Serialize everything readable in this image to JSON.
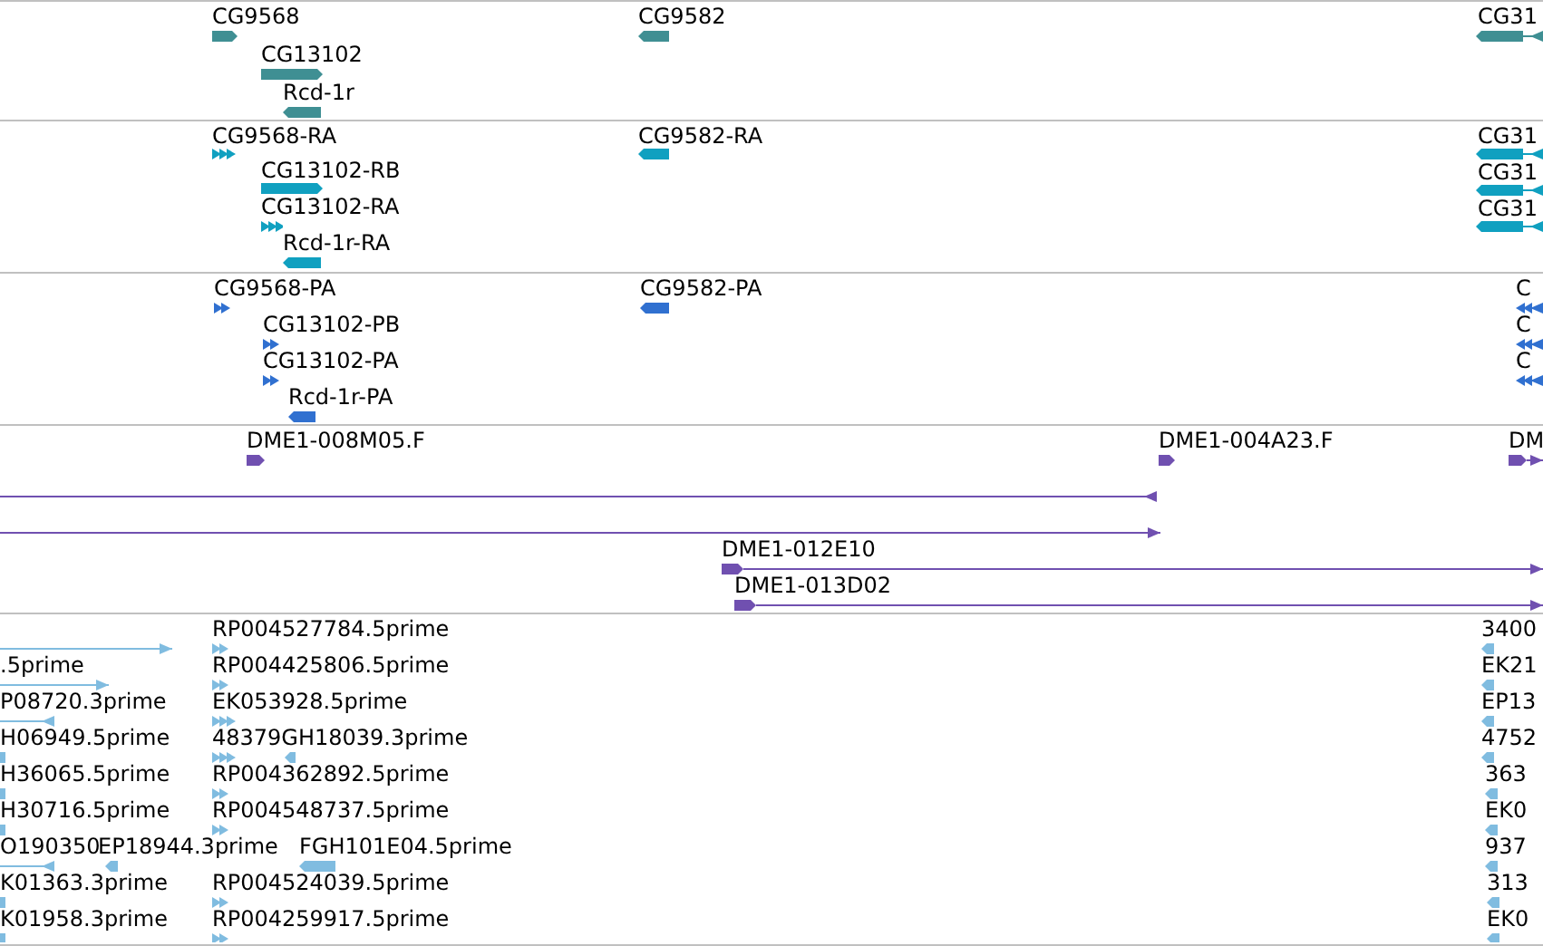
{
  "tracks": [
    {
      "color": "#3f8f93",
      "features": [
        {
          "label": "CG9568",
          "reverse": false
        },
        {
          "label": "CG13102",
          "reverse": false
        },
        {
          "label": "Rcd-1r",
          "reverse": true
        },
        {
          "label": "CG9582",
          "reverse": true
        },
        {
          "label": "CG31",
          "reverse": true
        }
      ]
    },
    {
      "color": "#10a0c0",
      "features": [
        {
          "label": "CG9568-RA",
          "reverse": false
        },
        {
          "label": "CG13102-RB",
          "reverse": false
        },
        {
          "label": "CG13102-RA",
          "reverse": false
        },
        {
          "label": "Rcd-1r-RA",
          "reverse": true
        },
        {
          "label": "CG9582-RA",
          "reverse": true
        },
        {
          "label": "CG31",
          "reverse": true
        },
        {
          "label": "CG31",
          "reverse": true
        },
        {
          "label": "CG31",
          "reverse": true
        }
      ]
    },
    {
      "color": "#3070d0",
      "features": [
        {
          "label": "CG9568-PA",
          "reverse": false
        },
        {
          "label": "CG13102-PB",
          "reverse": false
        },
        {
          "label": "CG13102-PA",
          "reverse": false
        },
        {
          "label": "Rcd-1r-PA",
          "reverse": true
        },
        {
          "label": "CG9582-PA",
          "reverse": true
        },
        {
          "label": "C",
          "reverse": true
        },
        {
          "label": "C",
          "reverse": true
        },
        {
          "label": "C",
          "reverse": true
        }
      ]
    },
    {
      "color": "#7050b0",
      "features": [
        {
          "label": "DME1-008M05.F",
          "reverse": false
        },
        {
          "label": "DME1-004A23.F",
          "reverse": false
        },
        {
          "label": "DM",
          "reverse": false
        },
        {
          "reverse": true
        },
        {
          "reverse": false
        },
        {
          "label": "DME1-012E10",
          "reverse": false
        },
        {
          "label": "DME1-013D02",
          "reverse": false
        }
      ]
    },
    {
      "color": "#80bce0",
      "features": [
        {
          "reverse": false
        },
        {
          "label": ".5prime",
          "reverse": false
        },
        {
          "label": "P08720.3prime",
          "reverse": true
        },
        {
          "label": "H06949.5prime"
        },
        {
          "label": "H36065.5prime"
        },
        {
          "label": "H30716.5prime"
        },
        {
          "label": "O190350",
          "reverse": true
        },
        {
          "label": "EP18944.3prime",
          "reverse": true
        },
        {
          "label": "K01363.3prime"
        },
        {
          "label": "K01958.3prime"
        },
        {
          "label": "RP004527784.5prime",
          "reverse": false
        },
        {
          "label": "RP004425806.5prime",
          "reverse": false
        },
        {
          "label": "EK053928.5prime",
          "reverse": false
        },
        {
          "label": "48379GH18039.3prime",
          "reverse": false
        },
        {
          "reverse": true
        },
        {
          "label": "RP004362892.5prime",
          "reverse": false
        },
        {
          "label": "RP004548737.5prime",
          "reverse": false
        },
        {
          "label": "FGH101E04.5prime",
          "reverse": true
        },
        {
          "label": "RP004524039.5prime",
          "reverse": false
        },
        {
          "label": "RP004259917.5prime",
          "reverse": false
        },
        {
          "label": "3400",
          "reverse": true
        },
        {
          "label": "EK21",
          "reverse": true
        },
        {
          "label": "EP13",
          "reverse": true
        },
        {
          "label": "4752",
          "reverse": true
        },
        {
          "label": "363",
          "reverse": true
        },
        {
          "label": "EK0",
          "reverse": true
        },
        {
          "label": "937",
          "reverse": true
        },
        {
          "label": "313",
          "reverse": true
        },
        {
          "label": "EK0",
          "reverse": true
        }
      ]
    }
  ]
}
